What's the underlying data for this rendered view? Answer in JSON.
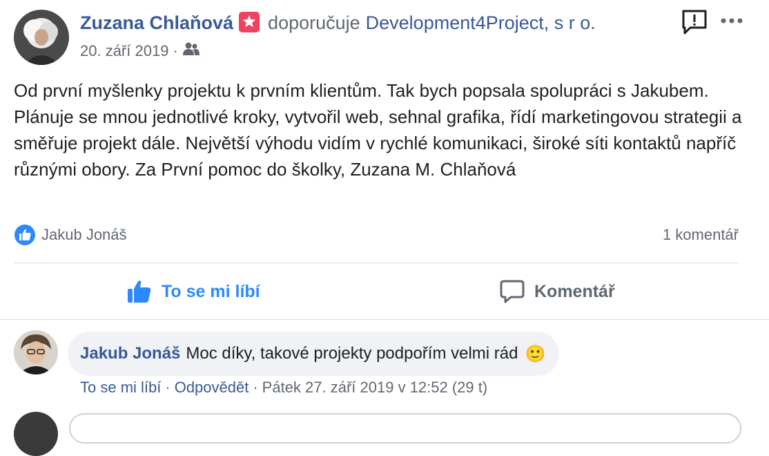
{
  "post": {
    "author": "Zuzana Chlaňová",
    "verb": "doporučuje",
    "page": "Development4Project, s r o.",
    "date": "20. září 2019",
    "dot": "·",
    "body": "Od první myšlenky projektu k prvním klientům. Tak bych popsala spolupráci s Jakubem. Plánuje se mnou jednotlivé kroky, vytvořil web, sehnal grafika, řídí marketingovou strategii a směřuje projekt dále. Největší výhodu vidím v rychlé komunikaci, široké síti kontaktů napříč různými obory. Za První pomoc do školky, Zuzana M. Chlaňová"
  },
  "reactions": {
    "reactor": "Jakub Jonáš",
    "comment_count": "1 komentář"
  },
  "actions": {
    "like_label": "To se mi líbí",
    "comment_label": "Komentář"
  },
  "comment": {
    "author": "Jakub Jonáš",
    "text": "Moc díky, takové projekty podpořím velmi rád",
    "emoji": "🙂",
    "like": "To se mi líbí",
    "reply": "Odpovědět",
    "sep": "·",
    "timestamp": "Pátek 27. září 2019 v 12:52 (29 t)"
  },
  "icons": {
    "recommend": "recommend-star-icon",
    "audience": "friends-audience-icon",
    "feedback": "feedback-exclamation-icon",
    "more": "more-dots-icon",
    "like_reaction": "like-reaction-icon",
    "like": "thumbs-up-icon",
    "comment": "speech-bubble-icon"
  },
  "colors": {
    "link": "#385898",
    "accent": "#2d88ff",
    "recommend_badge": "#f3425f",
    "muted": "#606770",
    "bubble": "#f0f2f5"
  }
}
